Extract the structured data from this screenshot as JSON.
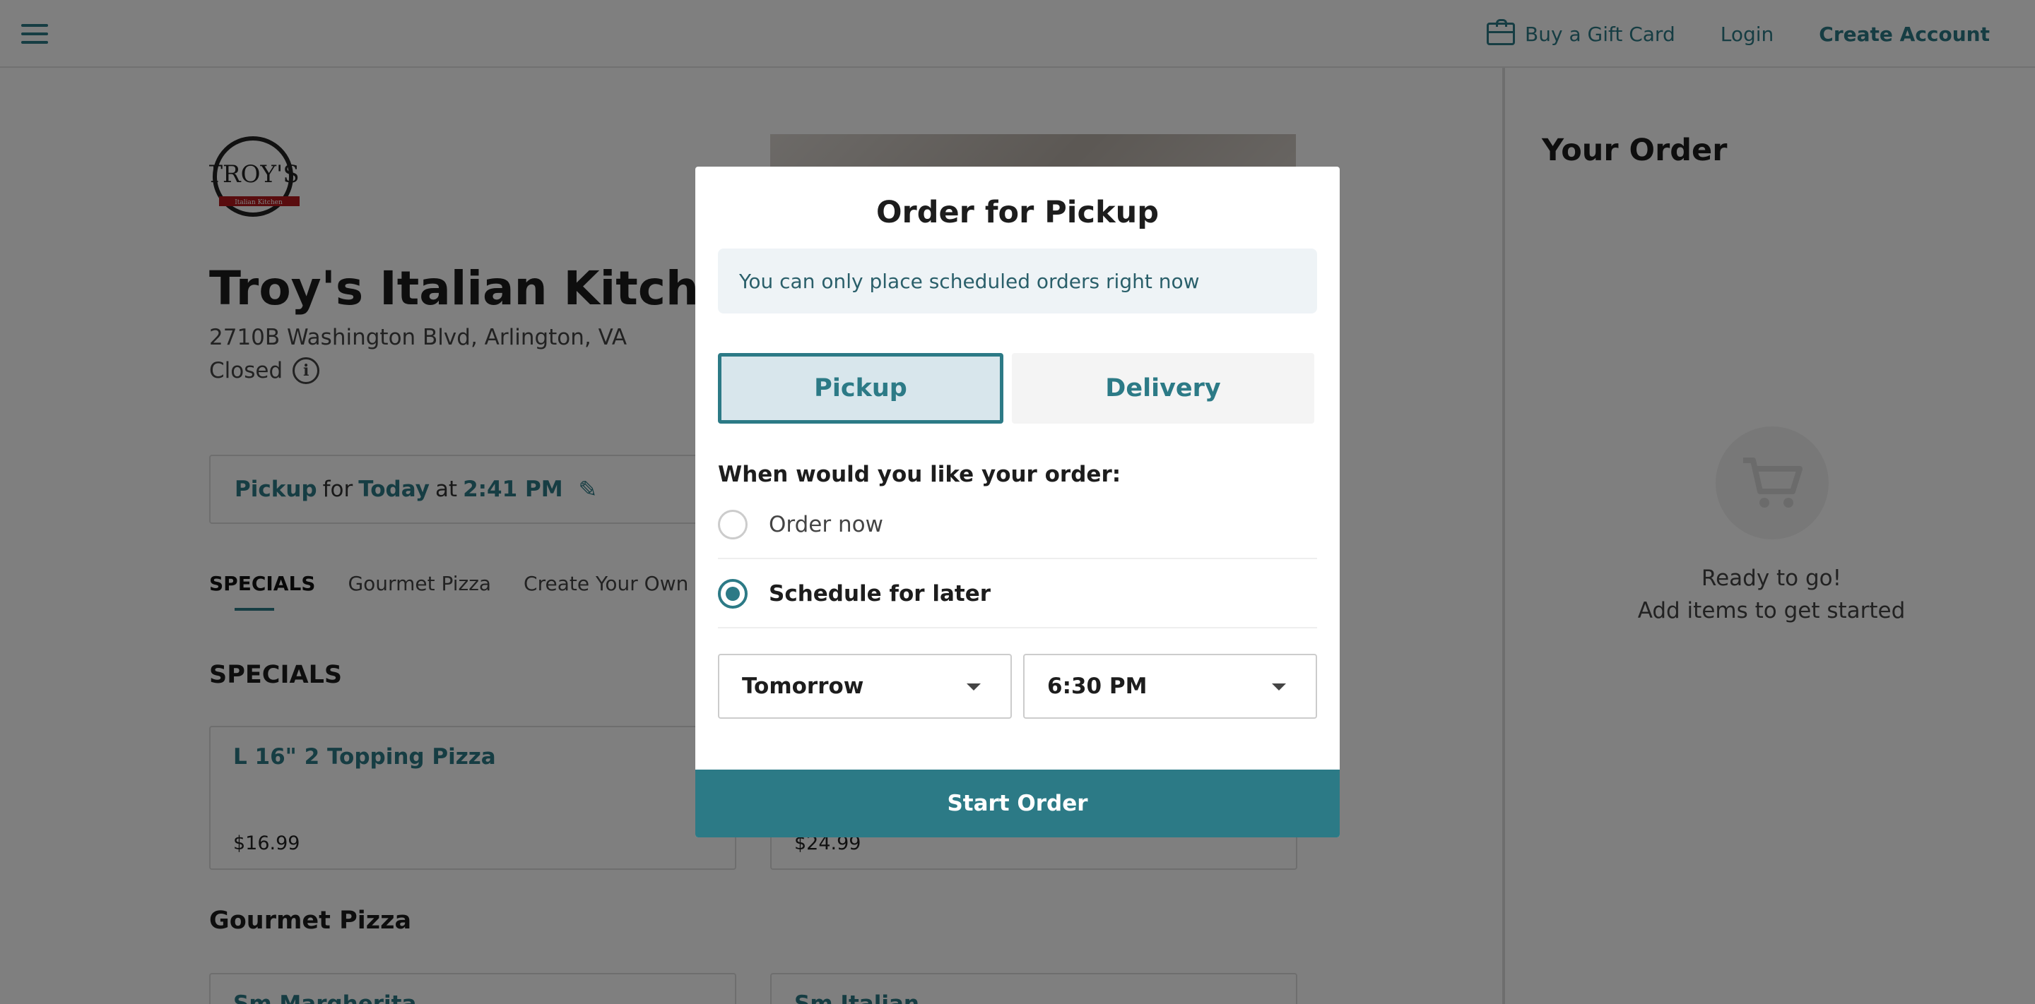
{
  "header": {
    "menu_icon": "hamburger-menu-icon",
    "gift_icon": "gift-card-icon",
    "gift_card_label": "Buy a Gift Card",
    "login_label": "Login",
    "create_account_label": "Create Account"
  },
  "restaurant": {
    "logo_text": "TROY'S",
    "logo_subtext": "Italian Kitchen",
    "name": "Troy's Italian Kitchen-",
    "address": "2710B Washington Blvd, Arlington, VA",
    "status": "Closed"
  },
  "pickup_bar": {
    "mode": "Pickup",
    "for_word": "for",
    "day": "Today",
    "at_word": "at",
    "time": "2:41 PM"
  },
  "category_tabs": [
    "SPECIALS",
    "Gourmet Pizza",
    "Create Your Own Pizza"
  ],
  "sections": [
    {
      "title": "SPECIALS",
      "items": [
        {
          "name": "L 16\" 2 Topping Pizza",
          "price": "$16.99"
        },
        {
          "name": "",
          "price": "$24.99"
        }
      ]
    },
    {
      "title": "Gourmet Pizza",
      "items": [
        {
          "name": "Sm Margherita",
          "price": ""
        },
        {
          "name": "Sm Italian",
          "price": ""
        }
      ]
    }
  ],
  "sidebar": {
    "title": "Your Order",
    "cart_icon": "shopping-cart-icon",
    "empty_line1": "Ready to go!",
    "empty_line2": "Add items to get started"
  },
  "modal": {
    "title": "Order for Pickup",
    "notice": "You can only place scheduled orders right now",
    "toggle_pickup": "Pickup",
    "toggle_delivery": "Delivery",
    "selected_toggle": "Pickup",
    "question": "When would you like your order:",
    "option_now": "Order now",
    "option_later": "Schedule for later",
    "selected_option": "Schedule for later",
    "day_select": "Tomorrow",
    "time_select": "6:30 PM",
    "start_button": "Start Order"
  },
  "colors": {
    "accent": "#2c7a86",
    "overlay": "rgba(0,0,0,0.5)"
  }
}
